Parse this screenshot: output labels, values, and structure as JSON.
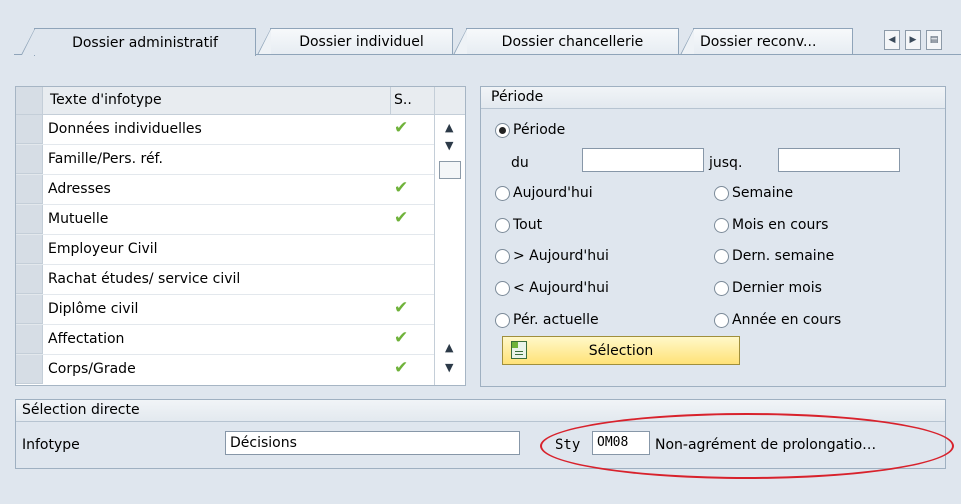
{
  "tabs": [
    {
      "label": "Dossier administratif",
      "active": true
    },
    {
      "label": "Dossier individuel",
      "active": false
    },
    {
      "label": "Dossier chancellerie",
      "active": false
    },
    {
      "label": "Dossier reconv...",
      "active": false
    }
  ],
  "tab_nav": {
    "left_icon": "triangle-left-icon",
    "right_icon": "triangle-right-icon",
    "menu_icon": "tab-list-icon"
  },
  "infotype_table": {
    "col_text": "Texte d'infotype",
    "col_s": "S..",
    "rows": [
      {
        "text": "Données individuelles",
        "check": "✔"
      },
      {
        "text": "Famille/Pers. réf.",
        "check": ""
      },
      {
        "text": "Adresses",
        "check": "✔"
      },
      {
        "text": "Mutuelle",
        "check": "✔"
      },
      {
        "text": "Employeur Civil",
        "check": ""
      },
      {
        "text": "Rachat études/ service civil",
        "check": ""
      },
      {
        "text": "Diplôme civil",
        "check": "✔"
      },
      {
        "text": "Affectation",
        "check": "✔"
      },
      {
        "text": "Corps/Grade",
        "check": "✔"
      }
    ]
  },
  "periode": {
    "title": "Période",
    "option_periode": "Période",
    "du_label": "du",
    "du_value": "",
    "jusq_label": "jusq.",
    "jusq_value": "",
    "options_left": [
      "Aujourd'hui",
      "Tout",
      "> Aujourd'hui",
      "< Aujourd'hui",
      "Pér. actuelle"
    ],
    "options_right": [
      "Semaine",
      "Mois en cours",
      "Dern. semaine",
      "Dernier mois",
      "Année en cours"
    ],
    "selection_button": "Sélection"
  },
  "selection_directe": {
    "title": "Sélection directe",
    "infotype_label": "Infotype",
    "infotype_value": "Décisions",
    "sty_label": "Sty",
    "sty_value": "OM08",
    "sty_description": "Non-agrément de prolongatio…"
  },
  "colors": {
    "check": "#6fb23a",
    "highlight_ellipse": "#d8222c",
    "button_yellow": "#ffe277"
  }
}
